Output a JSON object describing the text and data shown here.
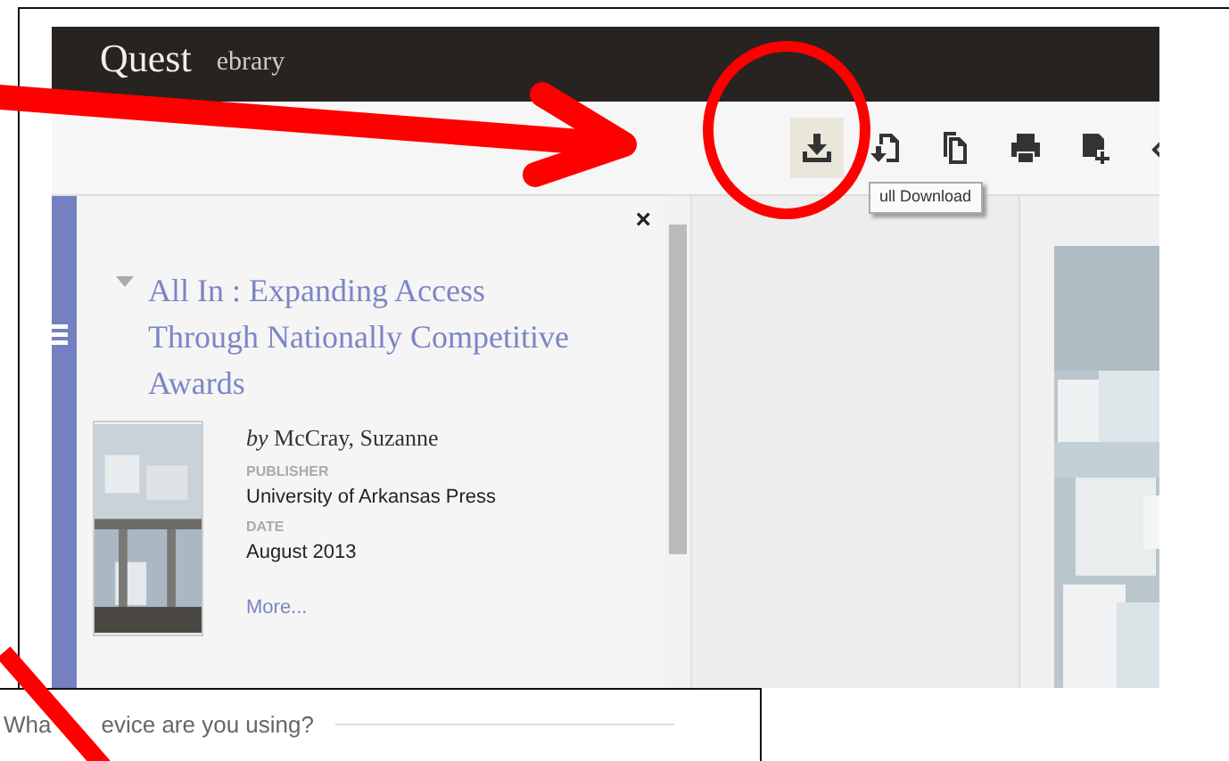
{
  "header": {
    "logo": "Quest",
    "product": "ebrary"
  },
  "toolbar": {
    "buttons": [
      {
        "kind": "download",
        "hovered": true
      },
      {
        "kind": "download-page",
        "hovered": false
      },
      {
        "kind": "copy",
        "hovered": false
      },
      {
        "kind": "print",
        "hovered": false
      },
      {
        "kind": "add-note",
        "hovered": false
      },
      {
        "kind": "link",
        "hovered": false
      }
    ],
    "tooltip": "ull Download"
  },
  "book_panel": {
    "close_button": "×",
    "expanded": true,
    "title": "All In : Expanding Access Through Nationally Competitive Awards",
    "author": "*by* McCray, Suzanne",
    "fields": [
      {
        "label": "PUBLISHER",
        "value": "University of Arkansas Press"
      },
      {
        "label": "DATE",
        "value": "August 2013"
      }
    ],
    "more_link": "More..."
  },
  "question_box": {
    "text_parts": [
      "Wha",
      "evice are you using?"
    ]
  }
}
